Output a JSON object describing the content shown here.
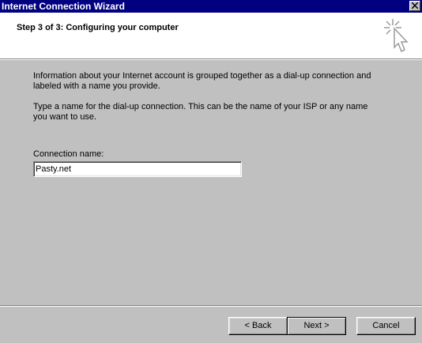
{
  "window": {
    "title": "Internet Connection Wizard"
  },
  "header": {
    "step_title": "Step 3 of 3: Configuring your computer"
  },
  "body": {
    "paragraph1": "Information about your Internet account is grouped together as a dial-up connection and labeled with a name you provide.",
    "paragraph2": "Type a name for the dial-up connection. This can be the name of your ISP or any name you want to use."
  },
  "connection_name": {
    "label": "Connection name:",
    "value": "Pasty.net"
  },
  "buttons": {
    "back_label": "< Back",
    "next_label": "Next >",
    "cancel_label": "Cancel"
  },
  "colors": {
    "title_bar": "#000080",
    "face": "#c0c0c0"
  }
}
